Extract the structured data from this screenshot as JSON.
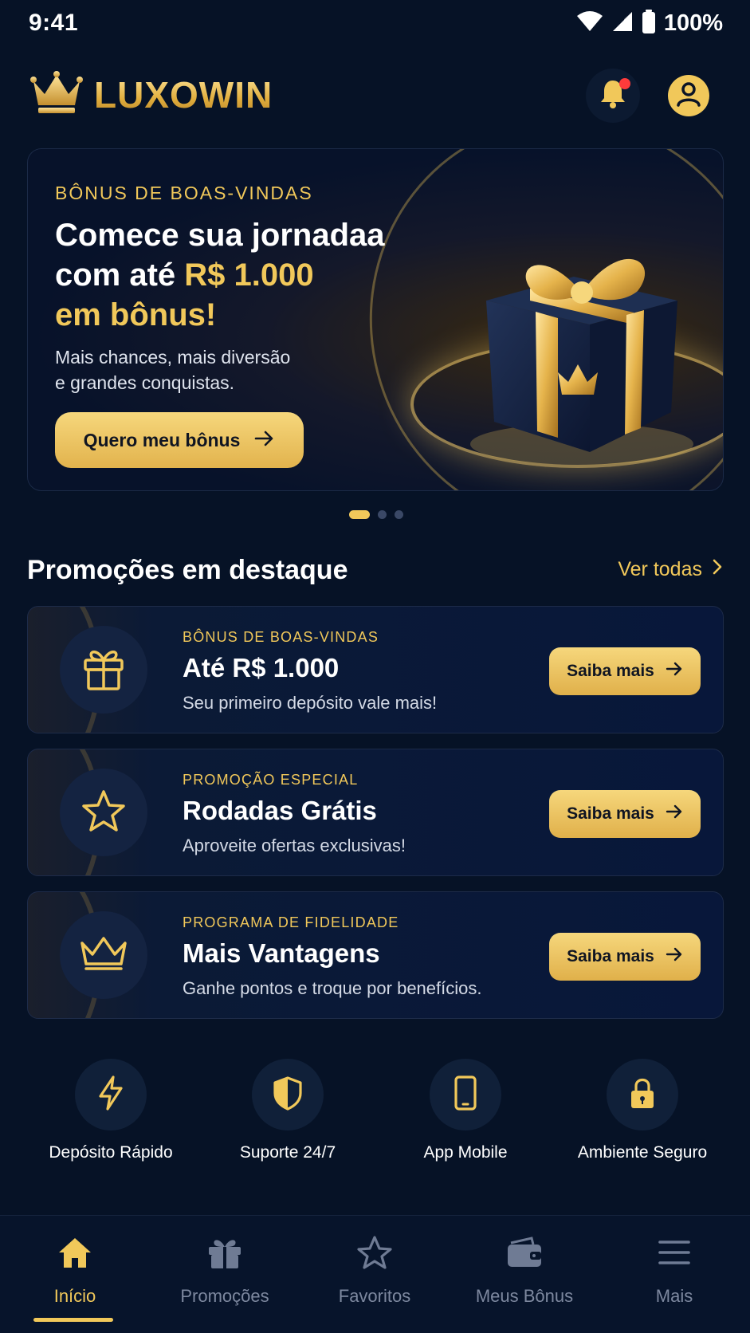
{
  "status_bar": {
    "time": "9:41",
    "battery": "100%"
  },
  "header": {
    "brand": "LUXOWIN"
  },
  "hero": {
    "eyebrow": "BÔNUS DE BOAS-VINDAS",
    "title_line1": "Comece sua jornadaa",
    "title_line2_prefix": "com até ",
    "title_line2_amount": "R$ 1.000",
    "title_line3": "em bônus!",
    "subtitle_line1": "Mais chances, mais diversão",
    "subtitle_line2": "e grandes conquistas.",
    "cta": "Quero meu bônus"
  },
  "carousel": {
    "active_index": 0,
    "count": 3
  },
  "section": {
    "title": "Promoções em destaque",
    "see_all": "Ver todas"
  },
  "promos": [
    {
      "icon": "gift-icon",
      "eyebrow": "BÔNUS DE BOAS-VINDAS",
      "title": "Até R$ 1.000",
      "subtitle": "Seu primeiro depósito vale mais!",
      "button": "Saiba mais"
    },
    {
      "icon": "star-icon",
      "eyebrow": "PROMOÇÃO ESPECIAL",
      "title": "Rodadas Grátis",
      "subtitle": "Aproveite ofertas exclusivas!",
      "button": "Saiba mais"
    },
    {
      "icon": "crown-icon",
      "eyebrow": "PROGRAMA DE FIDELIDADE",
      "title": "Mais Vantagens",
      "subtitle": "Ganhe pontos e troque por benefícios.",
      "button": "Saiba mais"
    }
  ],
  "features": [
    {
      "icon": "lightning-icon",
      "label": "Depósito Rápido"
    },
    {
      "icon": "shield-icon",
      "label": "Suporte 24/7"
    },
    {
      "icon": "smartphone-icon",
      "label": "App Mobile"
    },
    {
      "icon": "lock-icon",
      "label": "Ambiente Seguro"
    }
  ],
  "bottom_nav": [
    {
      "icon": "home-icon",
      "label": "Início",
      "active": true
    },
    {
      "icon": "gift-icon",
      "label": "Promoções",
      "active": false
    },
    {
      "icon": "star-icon",
      "label": "Favoritos",
      "active": false
    },
    {
      "icon": "wallet-icon",
      "label": "Meus Bônus",
      "active": false
    },
    {
      "icon": "menu-icon",
      "label": "Mais",
      "active": false
    }
  ],
  "colors": {
    "background": "#061226",
    "accent_gold": "#f1c85a",
    "nav_inactive": "#7d889f",
    "notification": "#ff3b3b"
  }
}
